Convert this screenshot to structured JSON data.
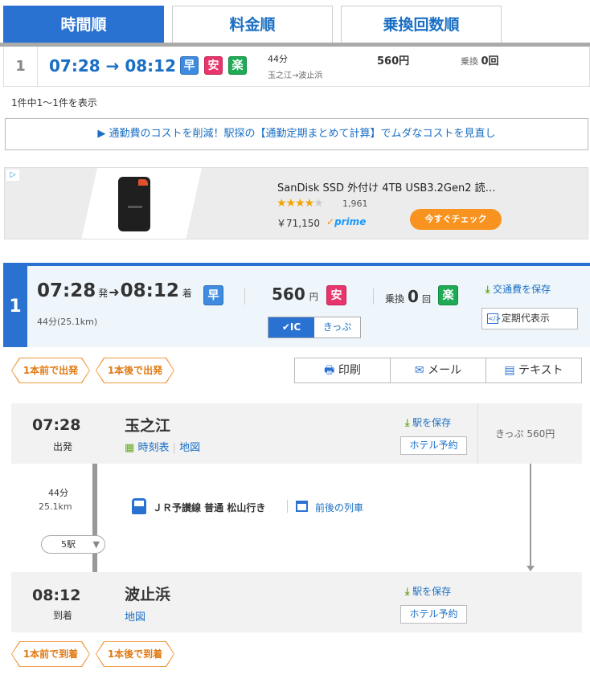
{
  "tabs": [
    {
      "label": "時間順"
    },
    {
      "label": "料金順"
    },
    {
      "label": "乗換回数順"
    }
  ],
  "summary": {
    "index": "1",
    "times": "07:28 → 08:12",
    "badges": [
      "早",
      "安",
      "楽"
    ],
    "duration": "44分",
    "route": "玉之江→波止浜",
    "fare": "560円",
    "transfers_label": "乗換",
    "transfers_value": "0回"
  },
  "result_count": "1件中1～1件を表示",
  "info_banner": "▶ 通勤費のコストを削減！駅探の【通勤定期まとめて計算】でムダなコストを見直し",
  "ad": {
    "title": "SanDisk SSD 外付け 4TB USB3.2Gen2 読…",
    "reviews": "1,961",
    "rating": 4.5,
    "price": "￥71,150",
    "prime": "prime",
    "cta": "今すぐチェック"
  },
  "detail": {
    "index": "1",
    "dep_time": "07:28",
    "dep_suffix": "発",
    "arr_time": "08:12",
    "arr_suffix": "着",
    "fast_badge": "早",
    "duration_distance": "44分(25.1km)",
    "fare_value": "560",
    "fare_unit": "円",
    "cheap_badge": "安",
    "ic_label": "IC",
    "ticket_label": "きっぷ",
    "transfer_label": "乗換",
    "transfer_value": "0",
    "transfer_unit": "回",
    "easy_badge": "楽",
    "save_fare": "交通費を保存",
    "commuter_pass": "定期代表示"
  },
  "nav": {
    "earlier_dep": "1本前で出発",
    "later_dep": "1本後で出発",
    "earlier_arr": "1本前で到着",
    "later_arr": "1本後で到着"
  },
  "actions": {
    "print": "印刷",
    "mail": "メール",
    "text": "テキスト"
  },
  "departure": {
    "time": "07:28",
    "type": "出発",
    "station": "玉之江",
    "timetable": "時刻表",
    "map": "地図",
    "save_station": "駅を保存",
    "hotel": "ホテル予約",
    "ticket_fare": "きっぷ 560円"
  },
  "segment": {
    "duration": "44分",
    "distance": "25.1km",
    "line": "ＪＲ予讃線 普通 松山行き",
    "prev_next": "前後の列車",
    "stops": "5駅"
  },
  "arrival": {
    "time": "08:12",
    "type": "到着",
    "station": "波止浜",
    "map": "地図",
    "save_station": "駅を保存",
    "hotel": "ホテル予約"
  },
  "colors": {
    "accent": "#2a72d2",
    "fast": "#3f8be0",
    "cheap": "#e8356d",
    "easy": "#1faa56",
    "orange": "#f09a3e",
    "cta": "#f7931e"
  }
}
